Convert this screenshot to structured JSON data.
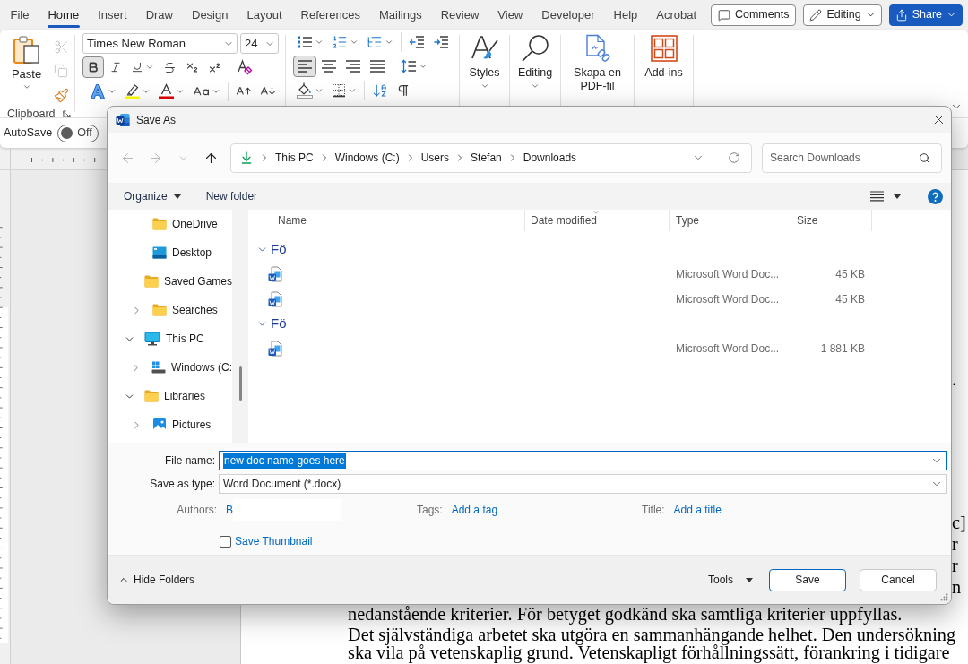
{
  "ribbon_tabs": [
    {
      "label": "File",
      "selected": false
    },
    {
      "label": "Home",
      "selected": true
    },
    {
      "label": "Insert",
      "selected": false
    },
    {
      "label": "Draw",
      "selected": false
    },
    {
      "label": "Design",
      "selected": false
    },
    {
      "label": "Layout",
      "selected": false
    },
    {
      "label": "References",
      "selected": false
    },
    {
      "label": "Mailings",
      "selected": false
    },
    {
      "label": "Review",
      "selected": false
    },
    {
      "label": "View",
      "selected": false
    },
    {
      "label": "Developer",
      "selected": false
    },
    {
      "label": "Help",
      "selected": false
    },
    {
      "label": "Acrobat",
      "selected": false
    }
  ],
  "header_buttons": [
    {
      "kind": "comments",
      "label": "Comments"
    },
    {
      "kind": "editing",
      "label": "Editing"
    },
    {
      "kind": "share",
      "label": "Share"
    }
  ],
  "ribbon": {
    "clipboard": {
      "paste": "Paste",
      "label": "Clipboard",
      "tools": [
        {
          "kind": "cut",
          "disabled": true
        },
        {
          "kind": "copy",
          "disabled": true
        },
        {
          "kind": "format_painter",
          "disabled": false
        }
      ]
    },
    "font": {
      "name": "Times New Roman",
      "size": "24",
      "toggles": [
        {
          "kind": "bold",
          "selected": true
        },
        {
          "kind": "italic",
          "selected": false
        },
        {
          "kind": "underline",
          "selected": false
        },
        {
          "kind": "strikethrough",
          "selected": false
        },
        {
          "kind": "subscript",
          "selected": false
        },
        {
          "kind": "superscript",
          "selected": false
        },
        {
          "kind": "clear_formatting",
          "selected": false
        }
      ],
      "effects": [
        {
          "kind": "text_effects"
        },
        {
          "kind": "highlight"
        },
        {
          "kind": "font_color"
        },
        {
          "kind": "change_case"
        },
        {
          "kind": "grow_font"
        },
        {
          "kind": "shrink_font"
        }
      ]
    },
    "paragraph": {
      "lists": [
        {
          "kind": "bullets"
        },
        {
          "kind": "numbering"
        },
        {
          "kind": "multilevel"
        },
        {
          "kind": "decrease_indent"
        },
        {
          "kind": "increase_indent"
        }
      ],
      "alignment": [
        {
          "kind": "left",
          "selected": true
        },
        {
          "kind": "center",
          "selected": false
        },
        {
          "kind": "right",
          "selected": false
        },
        {
          "kind": "justify",
          "selected": false
        }
      ],
      "spacing": [
        {
          "kind": "line_spacing"
        }
      ],
      "fill": [
        {
          "kind": "shading"
        },
        {
          "kind": "borders"
        },
        {
          "kind": "sort"
        },
        {
          "kind": "show_marks"
        }
      ]
    },
    "large_buttons": [
      {
        "kind": "styles",
        "label": "Styles"
      },
      {
        "kind": "find",
        "label": "Editing"
      },
      {
        "kind": "pdf",
        "label": "Skapa en PDF-fil"
      },
      {
        "kind": "addins",
        "label": "Add-ins"
      }
    ]
  },
  "autosave": {
    "label": "AutoSave",
    "state": "Off",
    "on": false
  },
  "document": {
    "right_edge_text": [
      [
        "."
      ],
      [
        "c]",
        "r",
        "r",
        "n"
      ]
    ],
    "paragraphs": [
      [
        "nedanstående kriterier. För betyget godkänd ska samtliga kriterier uppfyllas."
      ],
      [
        "Det självständiga arbetet ska utgöra en sammanhängande helhet. Den undersökning",
        "ska vila på vetenskaplig grund. Vetenskapligt förhållningssätt, förankring i tidigare"
      ]
    ]
  },
  "save_dialog": {
    "title": "Save As",
    "nav_buttons": [
      {
        "kind": "back",
        "disabled": true
      },
      {
        "kind": "forward",
        "disabled": true
      },
      {
        "kind": "recent",
        "disabled": true
      },
      {
        "kind": "up",
        "disabled": false
      }
    ],
    "path": [
      "This PC",
      "Windows (C:)",
      "Users",
      "Stefan",
      "Downloads"
    ],
    "search": {
      "placeholder": "Search Downloads"
    },
    "toolbar": {
      "organize": "Organize",
      "new_folder": "New folder"
    },
    "nav_pane": {
      "scrolled_children": [
        {
          "label": "OneDrive",
          "kind": "folder"
        },
        {
          "label": "Desktop",
          "kind": "desktop"
        },
        {
          "label": "Saved Games",
          "kind": "folder"
        },
        {
          "label": "Searches",
          "kind": "folder",
          "expanded": false
        }
      ],
      "items": [
        {
          "label": "This PC",
          "kind": "computer",
          "expanded": true,
          "children": [
            {
              "label": "Windows (C:",
              "kind": "drive",
              "expanded": false
            }
          ]
        },
        {
          "label": "Libraries",
          "kind": "folder",
          "expanded": true,
          "children": [
            {
              "label": "Pictures",
              "kind": "pictures",
              "expanded": false
            }
          ]
        }
      ]
    },
    "columns": [
      {
        "label": "Name",
        "sorted": false
      },
      {
        "label": "Date modified",
        "sorted": true
      },
      {
        "label": "Type",
        "sorted": false
      },
      {
        "label": "Size",
        "sorted": false
      }
    ],
    "groups": [
      {
        "label": "Fö",
        "expanded": true,
        "files": [
          {
            "type": "Microsoft Word Doc...",
            "size": "45 KB"
          },
          {
            "type": "Microsoft Word Doc...",
            "size": "45 KB"
          }
        ]
      },
      {
        "label": "Fö",
        "expanded": true,
        "files": [
          {
            "type": "Microsoft Word Doc...",
            "size": "1 881 KB"
          }
        ]
      }
    ],
    "file_name": {
      "label": "File name:",
      "value": "new doc name goes here",
      "selected": true
    },
    "save_as_type": {
      "label": "Save as type:",
      "value": "Word Document (*.docx)"
    },
    "properties": [
      {
        "label": "Authors:",
        "value": "B",
        "redacted": true
      },
      {
        "label": "Tags:",
        "value": "Add a tag",
        "redacted": false
      },
      {
        "label": "Title:",
        "value": "Add a title",
        "redacted": false
      }
    ],
    "thumbnail": {
      "label": "Save Thumbnail",
      "checked": false
    },
    "hide_folders": "Hide Folders",
    "tools": {
      "label": "Tools"
    },
    "buttons": [
      {
        "label": "Save",
        "default": true
      },
      {
        "label": "Cancel",
        "default": false
      }
    ]
  }
}
